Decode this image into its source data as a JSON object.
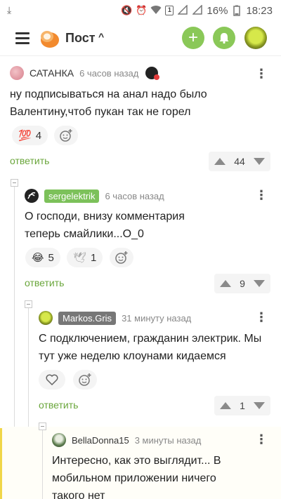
{
  "status": {
    "battery": "16%",
    "time": "18:23",
    "sim_badge": "1"
  },
  "header": {
    "title": "Пост"
  },
  "comments": [
    {
      "author": "САТАНКА",
      "time": "6 часов назад",
      "text_lines": [
        "ну подписываться на анал надо было",
        "Валентину,чтоб пукан так не горел"
      ],
      "reactions": [
        {
          "emoji": "💯",
          "count": "4"
        }
      ],
      "reply": "ответить",
      "votes": "44"
    },
    {
      "author": "sergelektrik",
      "author_tag_color": "#7cc15a",
      "time": "6 часов назад",
      "text_lines": [
        "О господи, внизу комментария",
        "теперь смайлики...О_0"
      ],
      "reactions": [
        {
          "emoji": "😂",
          "count": "5"
        },
        {
          "emoji": "🕊",
          "count": "1"
        }
      ],
      "reply": "ответить",
      "votes": "9"
    },
    {
      "author": "Markos.Gris",
      "author_tag_color": "#777777",
      "time": "31 минуту назад",
      "text_lines": [
        "С подключением, гражданин электрик. Мы",
        "тут уже неделю клоунами кидаемся"
      ],
      "reply": "ответить",
      "votes": "1"
    },
    {
      "author": "BellaDonna15",
      "time": "3 минуты назад",
      "text_lines": [
        "Интересно, как это выглядит... В",
        "мобильном приложении ничего",
        "такого нет"
      ]
    }
  ],
  "colors": {
    "accent_green": "#8ac858",
    "link_green": "#6aa63b",
    "highlight": "#f0d64a"
  }
}
